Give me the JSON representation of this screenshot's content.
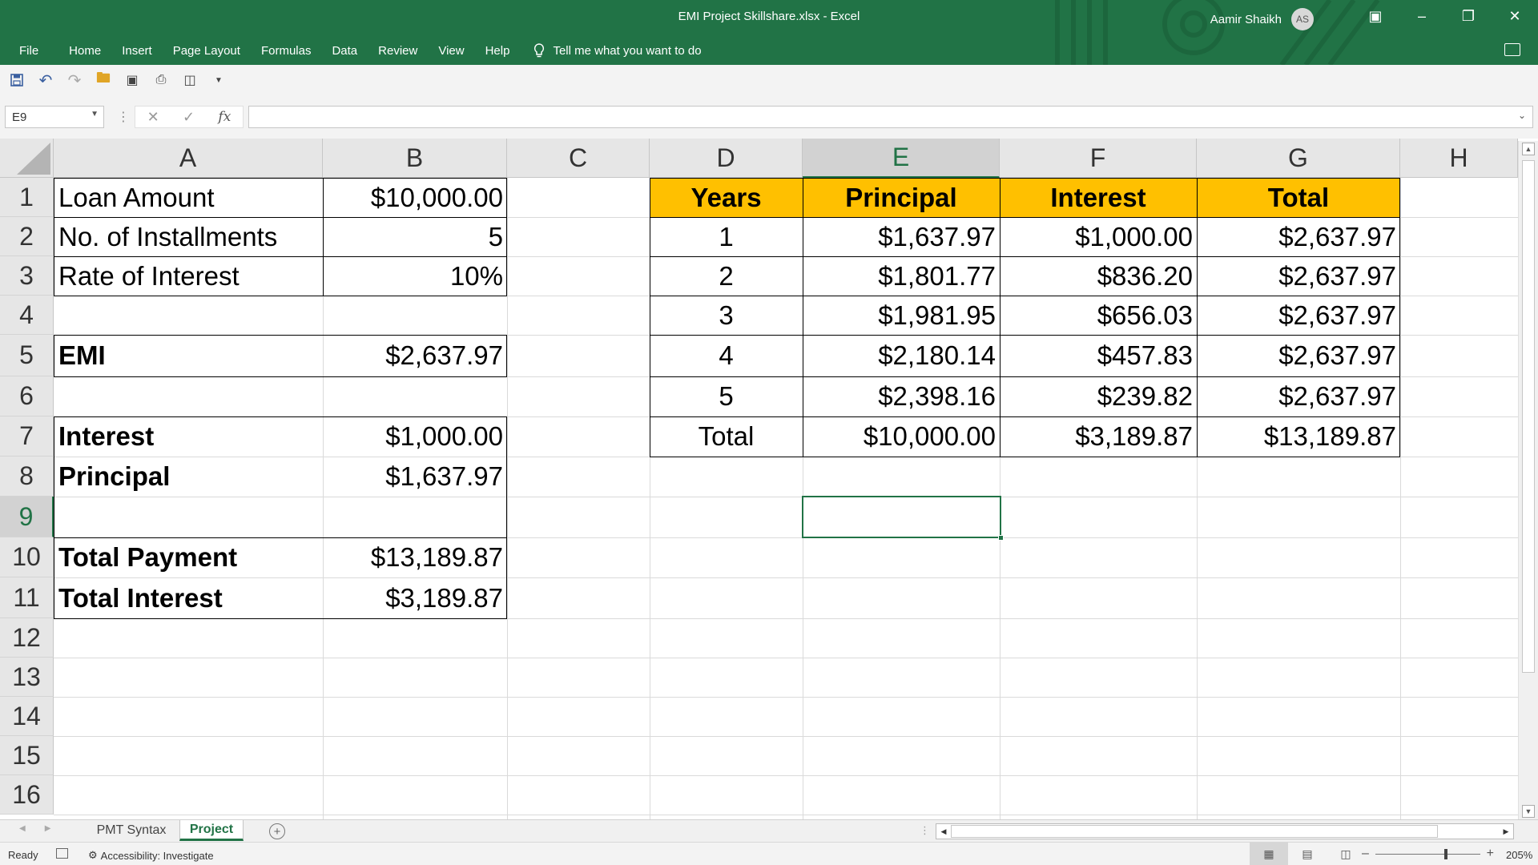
{
  "window": {
    "title": "EMI Project Skillshare.xlsx  -  Excel",
    "user_name": "Aamir Shaikh",
    "user_initials": "AS"
  },
  "ribbon": {
    "tabs": [
      "File",
      "Home",
      "Insert",
      "Page Layout",
      "Formulas",
      "Data",
      "Review",
      "View",
      "Help"
    ],
    "tell_me": "Tell me what you want to do"
  },
  "formula_bar": {
    "name_box": "E9",
    "formula": "",
    "fx_label": "fx"
  },
  "grid": {
    "columns": [
      "A",
      "B",
      "C",
      "D",
      "E",
      "F",
      "G",
      "H"
    ],
    "rows": [
      "1",
      "2",
      "3",
      "4",
      "5",
      "6",
      "7",
      "8",
      "9",
      "10",
      "11",
      "12",
      "13",
      "14",
      "15",
      "16"
    ],
    "selected_column": "E",
    "selected_row": "9",
    "summary": {
      "loan_amount_label": "Loan Amount",
      "loan_amount": "$10,000.00",
      "installments_label": "No. of Installments",
      "installments": "5",
      "rate_label": "Rate of Interest",
      "rate": "10%",
      "emi_label": "EMI",
      "emi": "$2,637.97",
      "interest_label": "Interest",
      "interest": "$1,000.00",
      "principal_label": "Principal",
      "principal": "$1,637.97",
      "total_payment_label": "Total Payment",
      "total_payment": "$13,189.87",
      "total_interest_label": "Total Interest",
      "total_interest": "$3,189.87"
    },
    "schedule": {
      "headers": [
        "Years",
        "Principal",
        "Interest",
        "Total"
      ],
      "rows": [
        [
          "1",
          "$1,637.97",
          "$1,000.00",
          "$2,637.97"
        ],
        [
          "2",
          "$1,801.77",
          "$836.20",
          "$2,637.97"
        ],
        [
          "3",
          "$1,981.95",
          "$656.03",
          "$2,637.97"
        ],
        [
          "4",
          "$2,180.14",
          "$457.83",
          "$2,637.97"
        ],
        [
          "5",
          "$2,398.16",
          "$239.82",
          "$2,637.97"
        ],
        [
          "Total",
          "$10,000.00",
          "$3,189.87",
          "$13,189.87"
        ]
      ],
      "header_color": "#ffc000"
    }
  },
  "sheets": {
    "tabs": [
      "PMT Syntax",
      "Project"
    ],
    "active": "Project"
  },
  "status_bar": {
    "ready": "Ready",
    "accessibility": "Accessibility: Investigate",
    "zoom_percent": "205%",
    "zoom_level": 205
  },
  "colors": {
    "accent": "#217346",
    "table_header": "#ffc000"
  }
}
